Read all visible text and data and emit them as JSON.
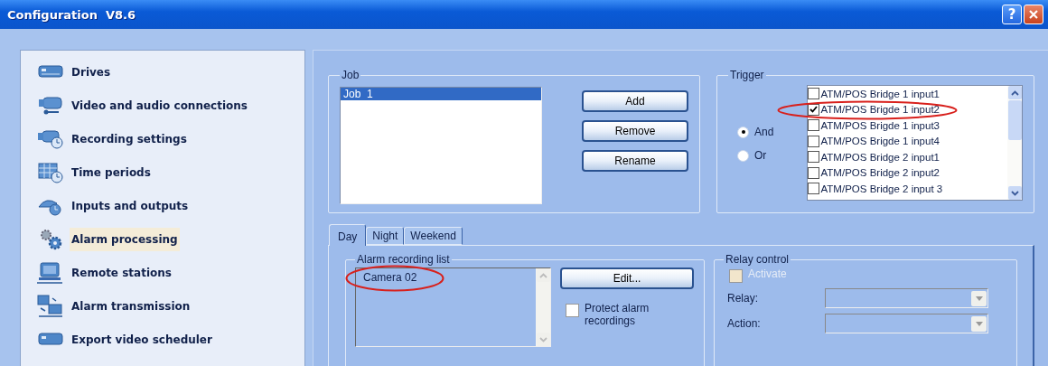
{
  "window": {
    "title": "Configuration  V8.6",
    "title_buttons": [
      "?"
    ]
  },
  "sidebar": {
    "items": [
      {
        "label": "Drives",
        "selected": false
      },
      {
        "label": "Video and audio connections",
        "selected": false
      },
      {
        "label": "Recording settings",
        "selected": false
      },
      {
        "label": "Time periods",
        "selected": false
      },
      {
        "label": "Inputs and outputs",
        "selected": false
      },
      {
        "label": "Alarm processing",
        "selected": true
      },
      {
        "label": "Remote stations",
        "selected": false
      },
      {
        "label": "Alarm transmission",
        "selected": false
      },
      {
        "label": "Export video scheduler",
        "selected": false
      }
    ]
  },
  "job": {
    "title": "Job",
    "items": [
      {
        "label": "Job  1",
        "selected": true
      }
    ],
    "buttons": [
      "Add",
      "Remove",
      "Rename"
    ]
  },
  "trigger": {
    "title": "Trigger",
    "modes": [
      {
        "label": "And",
        "selected": true
      },
      {
        "label": "Or",
        "selected": false
      }
    ],
    "inputs": [
      {
        "label": "ATM/POS Bridge 1 input1",
        "checked": false,
        "circled": false
      },
      {
        "label": "ATM/POS Brigde 1 input2",
        "checked": true,
        "circled": true
      },
      {
        "label": "ATM/POS Brigde 1 input3",
        "checked": false,
        "circled": false
      },
      {
        "label": "ATM/POS Brigde 1 input4",
        "checked": false,
        "circled": false
      },
      {
        "label": "ATM/POS Bridge 2 input1",
        "checked": false,
        "circled": false
      },
      {
        "label": "ATM/POS Bridge 2 input2",
        "checked": false,
        "circled": false
      },
      {
        "label": "ATM/POS Bridge 2 input 3",
        "checked": false,
        "circled": false
      }
    ]
  },
  "tabs": [
    {
      "label": "Day",
      "selected": true
    },
    {
      "label": "Night",
      "selected": false
    },
    {
      "label": "Weekend",
      "selected": false
    }
  ],
  "alarm_recording_list": {
    "title": "Alarm recording list",
    "items": [
      {
        "label": "Camera 02",
        "circled": true
      }
    ],
    "edit_button": "Edit...",
    "protect": {
      "label": "Protect alarm recordings",
      "checked": false
    }
  },
  "relay_control": {
    "title": "Relay control",
    "activate": {
      "label": "Activate",
      "checked": false,
      "disabled": true
    },
    "fields": [
      {
        "label": "Relay:",
        "disabled": true
      },
      {
        "label": "Action:",
        "disabled": true
      }
    ]
  }
}
